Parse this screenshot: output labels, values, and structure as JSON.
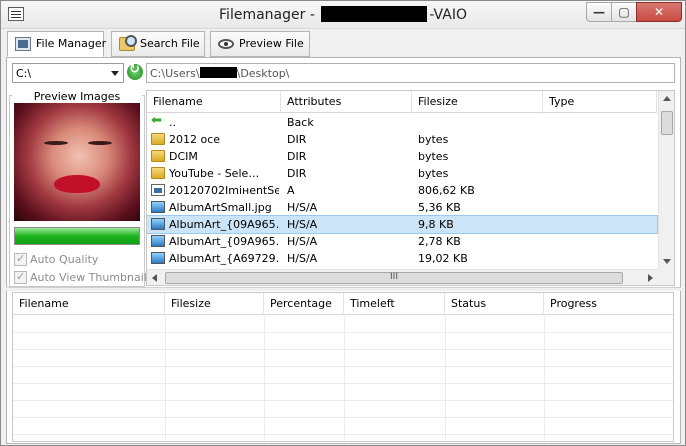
{
  "window": {
    "title_prefix": "Filemanager - ",
    "title_suffix": "-VAIO",
    "minimize": "—",
    "maximize": "▢",
    "close": "✕"
  },
  "tabs": [
    {
      "label": "File Manager",
      "icon": "file-manager-icon",
      "active": true
    },
    {
      "label": "Search File",
      "icon": "search-file-icon",
      "active": false
    },
    {
      "label": "Preview File",
      "icon": "eye-icon",
      "active": false
    }
  ],
  "drive": {
    "value": "C:\\"
  },
  "path": {
    "prefix": "C:\\Users\\",
    "suffix": "\\Desktop\\"
  },
  "preview": {
    "label": "Preview Images",
    "progress_fraction": 1.0,
    "auto_quality_label": "Auto Quality",
    "auto_view_thumbnail_label": "Auto View Thumbnail"
  },
  "filelist": {
    "columns": [
      "Filename",
      "Attributes",
      "Filesize",
      "Type"
    ],
    "rows": [
      {
        "icon": "back-arrow-icon",
        "name": "..",
        "attr": "Back",
        "size": "",
        "type": ""
      },
      {
        "icon": "folder-icon",
        "name": "2012 oce",
        "attr": "DIR",
        "size": " bytes",
        "type": ""
      },
      {
        "icon": "folder-icon",
        "name": "DCIM",
        "attr": "DIR",
        "size": " bytes",
        "type": ""
      },
      {
        "icon": "folder-icon",
        "name": "YouTube      - Sele…",
        "attr": "DIR",
        "size": " bytes",
        "type": ""
      },
      {
        "icon": "document-icon",
        "name": "20120702ImінentSe…",
        "attr": "A",
        "size": "806,62 KB",
        "type": ""
      },
      {
        "icon": "image-icon",
        "name": "AlbumArtSmall.jpg",
        "attr": "H/S/A",
        "size": "5,36 KB",
        "type": ""
      },
      {
        "icon": "image-icon",
        "name": "AlbumArt_{09A965…",
        "attr": "H/S/A",
        "size": "9,8 KB",
        "type": "",
        "selected": true
      },
      {
        "icon": "image-icon",
        "name": "AlbumArt_{09A965…",
        "attr": "H/S/A",
        "size": "2,78 KB",
        "type": ""
      },
      {
        "icon": "image-icon",
        "name": "AlbumArt_{A69729…",
        "attr": "H/S/A",
        "size": "19,02 KB",
        "type": ""
      }
    ],
    "hscroll_grip": "III"
  },
  "transfers": {
    "columns": [
      "Filename",
      "Filesize",
      "Percentage",
      "Timeleft",
      "Status",
      "Progress"
    ]
  },
  "colors": {
    "progress_green": "#1fb31f",
    "selection": "#cce4f7",
    "close_button": "#c9493f"
  }
}
